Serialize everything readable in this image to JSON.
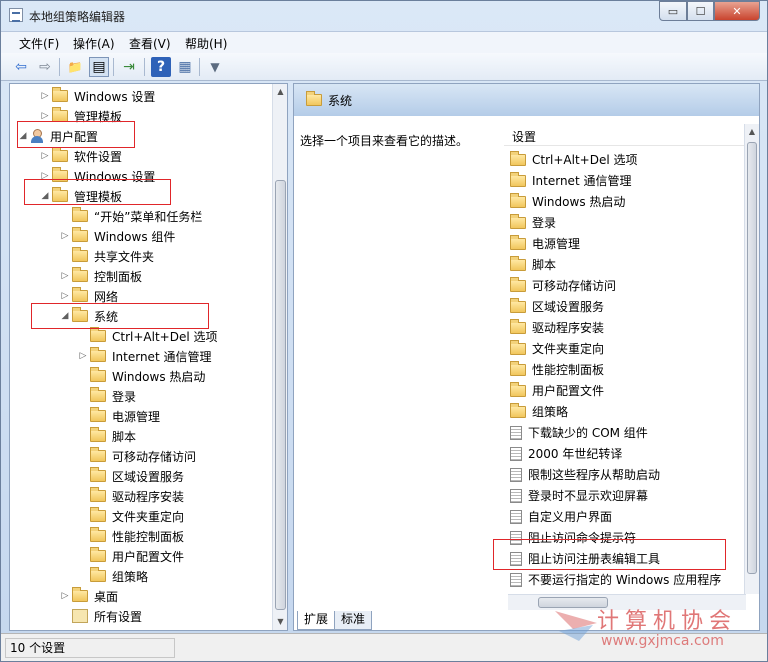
{
  "window": {
    "title": "本地组策略编辑器"
  },
  "titlebar": {
    "min": "▭",
    "max": "☐",
    "close": "✕"
  },
  "menu": [
    "文件(F)",
    "操作(A)",
    "查看(V)",
    "帮助(H)"
  ],
  "toolbar": {
    "back": "⇦",
    "forward": "⇨",
    "up": "📁",
    "show_tree": "▤",
    "export": "⇥",
    "help": "?",
    "properties": "▦",
    "filter": "▼"
  },
  "tree": [
    {
      "label": "Windows 设置",
      "arrow": "▷",
      "icon": "folder"
    },
    {
      "label": "管理模板",
      "arrow": "▷",
      "icon": "folder"
    },
    {
      "label": "用户配置",
      "arrow": "◢",
      "icon": "user"
    },
    {
      "label": "软件设置",
      "arrow": "▷",
      "icon": "folder"
    },
    {
      "label": "Windows 设置",
      "arrow": "▷",
      "icon": "folder"
    },
    {
      "label": "管理模板",
      "arrow": "◢",
      "icon": "folder"
    },
    {
      "label": "“开始”菜单和任务栏",
      "arrow": "",
      "icon": "folder"
    },
    {
      "label": "Windows 组件",
      "arrow": "▷",
      "icon": "folder"
    },
    {
      "label": "共享文件夹",
      "arrow": "",
      "icon": "folder"
    },
    {
      "label": "控制面板",
      "arrow": "▷",
      "icon": "folder"
    },
    {
      "label": "网络",
      "arrow": "▷",
      "icon": "folder"
    },
    {
      "label": "系统",
      "arrow": "◢",
      "icon": "folder"
    },
    {
      "label": "Ctrl+Alt+Del 选项",
      "arrow": "",
      "icon": "folder"
    },
    {
      "label": "Internet 通信管理",
      "arrow": "▷",
      "icon": "folder"
    },
    {
      "label": "Windows 热启动",
      "arrow": "",
      "icon": "folder"
    },
    {
      "label": "登录",
      "arrow": "",
      "icon": "folder"
    },
    {
      "label": "电源管理",
      "arrow": "",
      "icon": "folder"
    },
    {
      "label": "脚本",
      "arrow": "",
      "icon": "folder"
    },
    {
      "label": "可移动存储访问",
      "arrow": "",
      "icon": "folder"
    },
    {
      "label": "区域设置服务",
      "arrow": "",
      "icon": "folder"
    },
    {
      "label": "驱动程序安装",
      "arrow": "",
      "icon": "folder"
    },
    {
      "label": "文件夹重定向",
      "arrow": "",
      "icon": "folder"
    },
    {
      "label": "性能控制面板",
      "arrow": "",
      "icon": "folder"
    },
    {
      "label": "用户配置文件",
      "arrow": "",
      "icon": "folder"
    },
    {
      "label": "组策略",
      "arrow": "",
      "icon": "folder"
    },
    {
      "label": "桌面",
      "arrow": "▷",
      "icon": "folder"
    },
    {
      "label": "所有设置",
      "arrow": "",
      "icon": "settings"
    }
  ],
  "right": {
    "header": "系统",
    "description": "选择一个项目来查看它的描述。",
    "column": "设置",
    "items": [
      {
        "label": "Ctrl+Alt+Del 选项",
        "icon": "folder"
      },
      {
        "label": "Internet 通信管理",
        "icon": "folder"
      },
      {
        "label": "Windows 热启动",
        "icon": "folder"
      },
      {
        "label": "登录",
        "icon": "folder"
      },
      {
        "label": "电源管理",
        "icon": "folder"
      },
      {
        "label": "脚本",
        "icon": "folder"
      },
      {
        "label": "可移动存储访问",
        "icon": "folder"
      },
      {
        "label": "区域设置服务",
        "icon": "folder"
      },
      {
        "label": "驱动程序安装",
        "icon": "folder"
      },
      {
        "label": "文件夹重定向",
        "icon": "folder"
      },
      {
        "label": "性能控制面板",
        "icon": "folder"
      },
      {
        "label": "用户配置文件",
        "icon": "folder"
      },
      {
        "label": "组策略",
        "icon": "folder"
      },
      {
        "label": "下载缺少的 COM 组件",
        "icon": "policy"
      },
      {
        "label": "2000 年世纪转译",
        "icon": "policy"
      },
      {
        "label": "限制这些程序从帮助启动",
        "icon": "policy"
      },
      {
        "label": "登录时不显示欢迎屏幕",
        "icon": "policy"
      },
      {
        "label": "自定义用户界面",
        "icon": "policy"
      },
      {
        "label": "阻止访问命令提示符",
        "icon": "policy"
      },
      {
        "label": "阻止访问注册表编辑工具",
        "icon": "policy"
      },
      {
        "label": "不要运行指定的 Windows 应用程序",
        "icon": "policy"
      }
    ],
    "tabs": [
      "扩展",
      "标准"
    ]
  },
  "status": "10 个设置",
  "watermark": {
    "title": "计算机协会",
    "url": "www.gxjmca.com"
  }
}
